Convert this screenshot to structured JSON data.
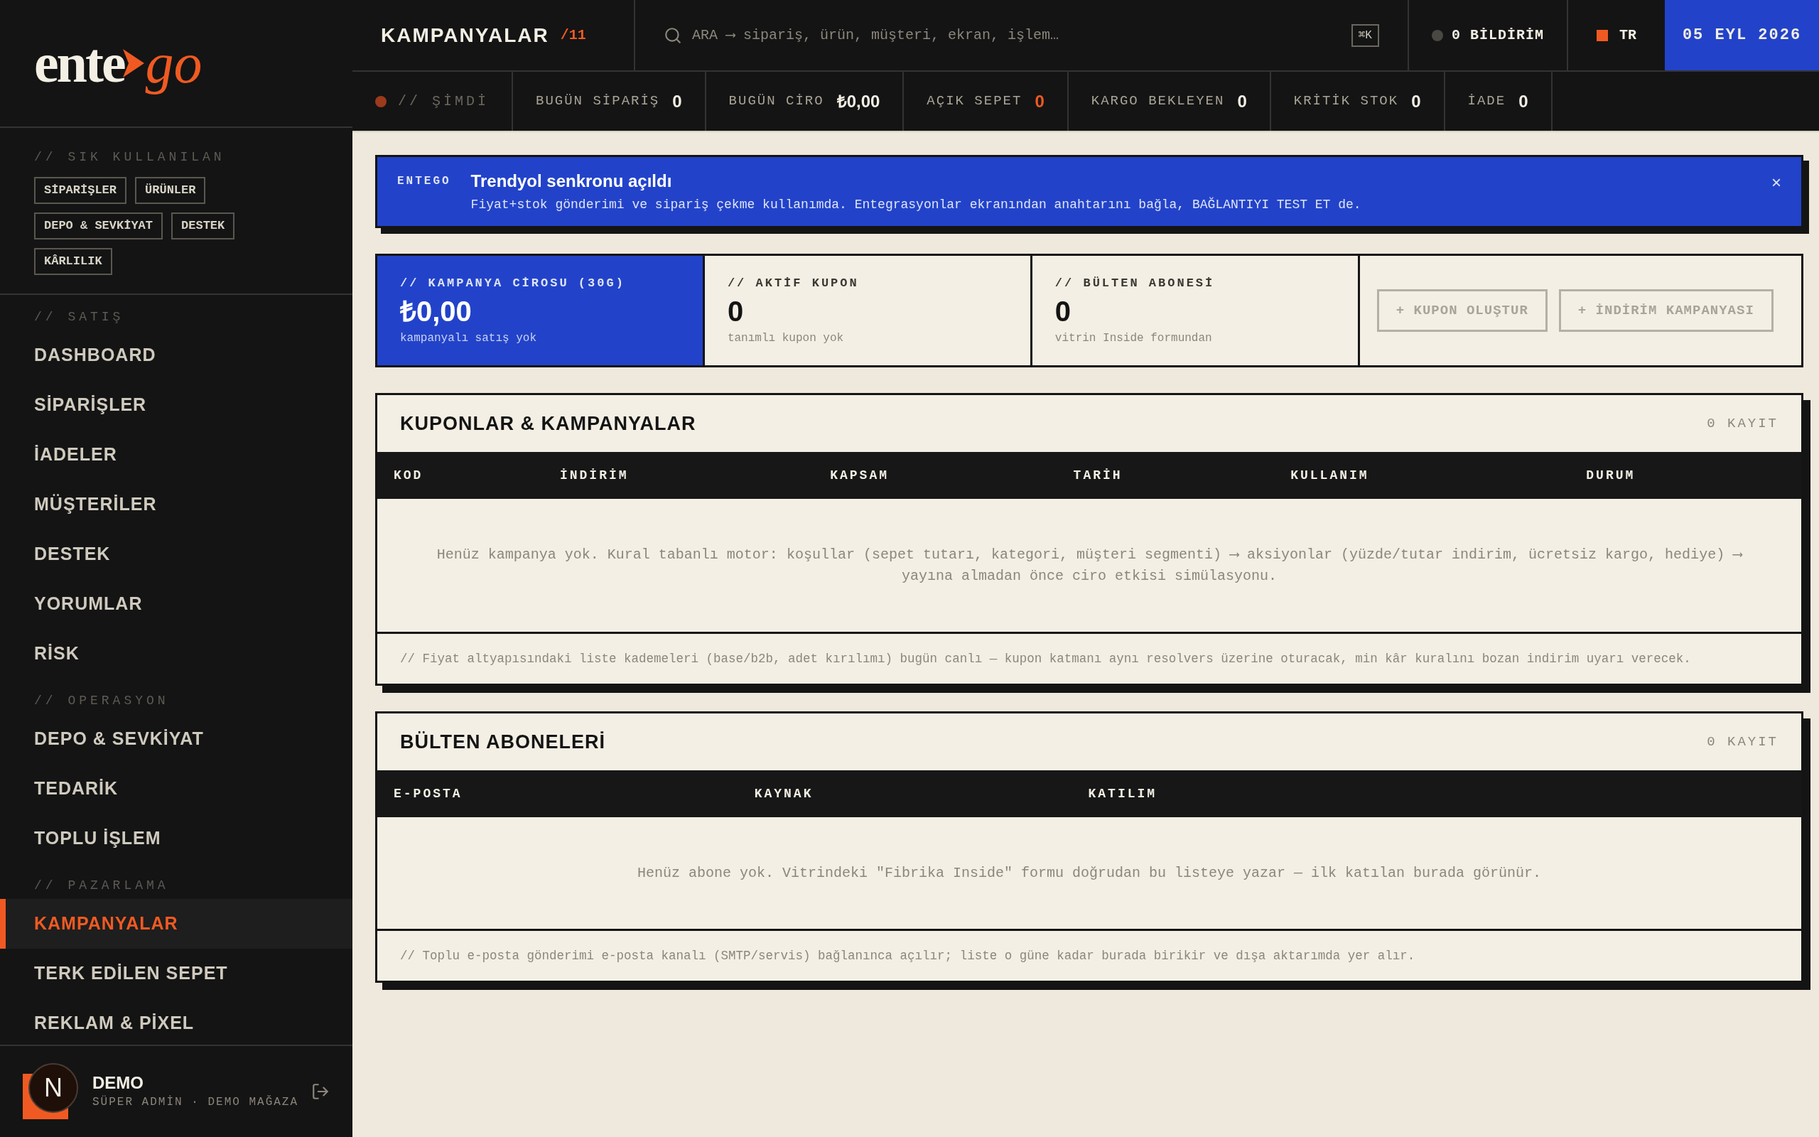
{
  "logo": {
    "main": "ente",
    "accent": "go"
  },
  "sidebar": {
    "shortcuts_label": "// SIK KULLANILAN",
    "shortcuts": [
      "SİPARİŞLER",
      "ÜRÜNLER",
      "DEPO & SEVKİYAT",
      "DESTEK",
      "KÂRLILIK"
    ],
    "sections": [
      {
        "label": "// SATIŞ",
        "items": [
          {
            "label": "DASHBOARD",
            "selected": false
          },
          {
            "label": "SİPARİŞLER",
            "selected": false
          },
          {
            "label": "İADELER",
            "selected": false
          },
          {
            "label": "MÜŞTERİLER",
            "selected": false
          },
          {
            "label": "DESTEK",
            "selected": false
          },
          {
            "label": "YORUMLAR",
            "selected": false
          },
          {
            "label": "RİSK",
            "selected": false
          }
        ]
      },
      {
        "label": "// OPERASYON",
        "items": [
          {
            "label": "DEPO & SEVKİYAT",
            "selected": false
          },
          {
            "label": "TEDARİK",
            "selected": false
          },
          {
            "label": "TOPLU İŞLEM",
            "selected": false
          }
        ]
      },
      {
        "label": "// PAZARLAMA",
        "items": [
          {
            "label": "KAMPANYALAR",
            "selected": true
          },
          {
            "label": "TERK EDİLEN SEPET",
            "selected": false
          },
          {
            "label": "REKLAM & PİXEL",
            "selected": false
          }
        ]
      }
    ],
    "user": {
      "avatar": "N",
      "name": "DEMO",
      "role": "SÜPER ADMİN · DEMO MAĞAZA"
    }
  },
  "topbar": {
    "title": "KAMPANYALAR",
    "count": "/11",
    "search": {
      "placeholder": "ARA ⟶ sipariş, ürün, müşteri, ekran, işlem…",
      "shortcut": "⌘K"
    },
    "notifications": "0 BİLDİRİM",
    "language": "TR",
    "date": "05 EYL 2026"
  },
  "ticker": {
    "label": "// ŞİMDİ",
    "items": [
      {
        "label": "BUGÜN SİPARİŞ",
        "value": "0",
        "alert": false
      },
      {
        "label": "BUGÜN CİRO",
        "value": "₺0,00",
        "alert": false
      },
      {
        "label": "AÇIK SEPET",
        "value": "0",
        "alert": true
      },
      {
        "label": "KARGO BEKLEYEN",
        "value": "0",
        "alert": false
      },
      {
        "label": "KRİTİK STOK",
        "value": "0",
        "alert": false
      },
      {
        "label": "İADE",
        "value": "0",
        "alert": false
      }
    ]
  },
  "banner": {
    "source": "ENTEGO",
    "title": "Trendyol senkronu açıldı",
    "text": "Fiyat+stok gönderimi ve sipariş çekme kullanımda. Entegrasyonlar ekranından anahtarını bağla, BAĞLANTIYI TEST ET de.",
    "close": "×"
  },
  "stats": [
    {
      "label": "// KAMPANYA CİROSU (30G)",
      "value": "₺0,00",
      "note": "kampanyalı satış yok",
      "highlight": true
    },
    {
      "label": "// AKTİF KUPON",
      "value": "0",
      "note": "tanımlı kupon yok",
      "highlight": false
    },
    {
      "label": "// BÜLTEN ABONESİ",
      "value": "0",
      "note": "vitrin Inside formundan",
      "highlight": false
    }
  ],
  "actions": [
    {
      "label": "+ KUPON OLUŞTUR",
      "disabled": true
    },
    {
      "label": "+ İNDİRİM KAMPANYASI",
      "disabled": true
    }
  ],
  "panels": [
    {
      "title": "KUPONLAR & KAMPANYALAR",
      "count": "0 KAYIT",
      "columns": [
        "KOD",
        "İNDİRİM",
        "KAPSAM",
        "TARİH",
        "KULLANIM",
        "DURUM"
      ],
      "empty": "Henüz kampanya yok. Kural tabanlı motor: koşullar (sepet tutarı, kategori, müşteri segmenti) ⟶ aksiyonlar (yüzde/tutar indirim, ücretsiz kargo, hediye) ⟶ yayına almadan önce ciro etkisi simülasyonu.",
      "footnote": "// Fiyat altyapısındaki liste kademeleri (base/b2b, adet kırılımı) bugün canlı — kupon katmanı aynı resolvers üzerine oturacak, min kâr kuralını bozan indirim uyarı verecek."
    },
    {
      "title": "BÜLTEN ABONELERİ",
      "count": "0 KAYIT",
      "columns": [
        "E-POSTA",
        "KAYNAK",
        "KATILIM"
      ],
      "empty": "Henüz abone yok. Vitrindeki \"Fibrika Inside\" formu doğrudan bu listeye yazar — ilk katılan burada görünür.",
      "footnote": "// Toplu e-posta gönderimi e-posta kanalı (SMTP/servis) bağlanınca açılır; liste o güne kadar burada birikir ve dışa aktarımda yer alır."
    }
  ]
}
